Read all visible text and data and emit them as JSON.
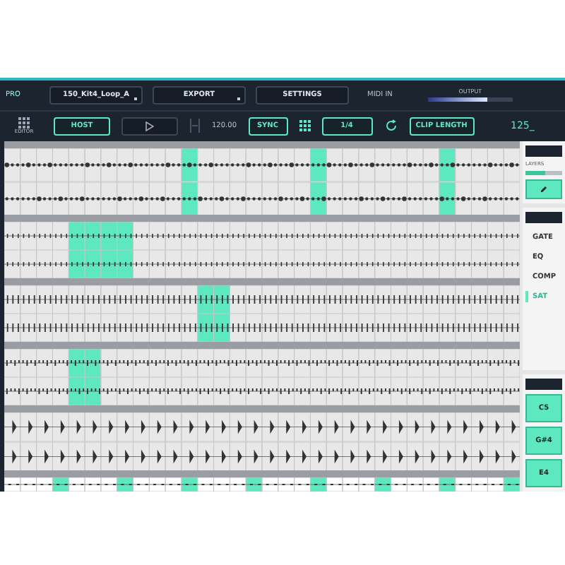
{
  "toolbar": {
    "logo": "PRO",
    "clip_name": "150_Kit4_Loop_A",
    "export": "EXPORT",
    "settings": "SETTINGS",
    "midi_label": "MIDI IN",
    "output_label": "OUTPUT",
    "output_meter": {
      "level": 0.7
    },
    "editor_label": "EDITOR",
    "host": "HOST",
    "tempo": "120.00",
    "sync": "SYNC",
    "grid": "1/4",
    "clip_length": "CLIP LENGTH",
    "readout": "125_"
  },
  "tracks": [
    {
      "kind": "dots",
      "steps": [
        false,
        false,
        false,
        false,
        false,
        false,
        false,
        false,
        false,
        false,
        false,
        true,
        false,
        false,
        false,
        false,
        false,
        false,
        false,
        true,
        false,
        false,
        false,
        false,
        false,
        false,
        false,
        true,
        false,
        false,
        false,
        false
      ]
    },
    {
      "kind": "ticks",
      "steps": [
        false,
        false,
        false,
        false,
        true,
        true,
        true,
        true,
        false,
        false,
        false,
        false,
        false,
        false,
        false,
        false,
        false,
        false,
        false,
        false,
        false,
        false,
        false,
        false,
        false,
        false,
        false,
        false,
        false,
        false,
        false,
        false
      ]
    },
    {
      "kind": "spikes",
      "steps": [
        false,
        false,
        false,
        false,
        false,
        false,
        false,
        false,
        false,
        false,
        false,
        false,
        true,
        true,
        false,
        false,
        false,
        false,
        false,
        false,
        false,
        false,
        false,
        false,
        false,
        false,
        false,
        false,
        false,
        false,
        false,
        false
      ]
    },
    {
      "kind": "dense",
      "steps": [
        false,
        false,
        false,
        false,
        true,
        true,
        false,
        false,
        false,
        false,
        false,
        false,
        false,
        false,
        false,
        false,
        false,
        false,
        false,
        false,
        false,
        false,
        false,
        false,
        false,
        false,
        false,
        false,
        false,
        false,
        false,
        false
      ]
    },
    {
      "kind": "bursts",
      "steps": [
        false,
        false,
        false,
        false,
        false,
        false,
        false,
        false,
        false,
        false,
        false,
        false,
        false,
        false,
        false,
        false,
        false,
        false,
        false,
        false,
        false,
        false,
        false,
        false,
        false,
        false,
        false,
        false,
        false,
        false,
        false,
        false
      ]
    },
    {
      "kind": "steps",
      "steps": [
        false,
        false,
        false,
        true,
        false,
        false,
        false,
        true,
        false,
        false,
        false,
        true,
        false,
        false,
        false,
        true,
        false,
        false,
        false,
        true,
        false,
        false,
        false,
        true,
        false,
        false,
        false,
        true,
        false,
        false,
        false,
        true
      ]
    }
  ],
  "side": {
    "layer_label": "LAYERS",
    "layer_slider": {
      "level": 0.55
    },
    "effects": [
      {
        "label": "GATE",
        "selected": false
      },
      {
        "label": "EQ",
        "selected": false
      },
      {
        "label": "COMP",
        "selected": false
      },
      {
        "label": "SAT",
        "selected": true
      }
    ],
    "pads": [
      "C5",
      "G#4",
      "E4"
    ]
  }
}
